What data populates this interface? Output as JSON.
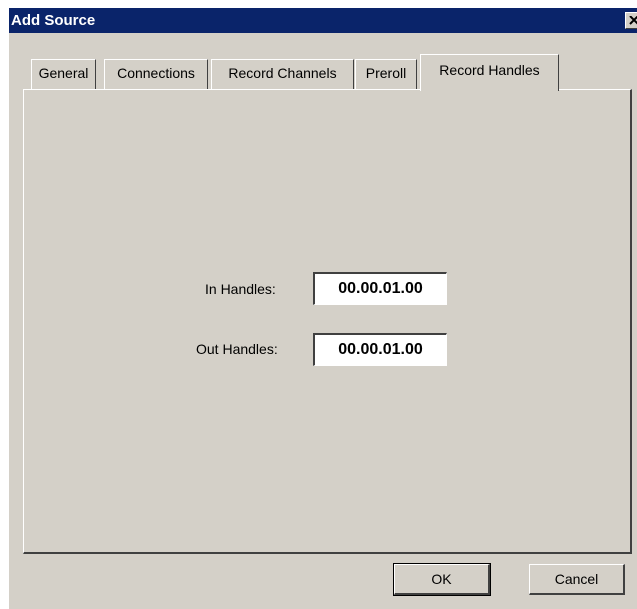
{
  "window": {
    "title": "Add Source"
  },
  "tabs": [
    {
      "label": "General",
      "active": false
    },
    {
      "label": "Connections",
      "active": false
    },
    {
      "label": "Record Channels",
      "active": false
    },
    {
      "label": "Preroll",
      "active": false
    },
    {
      "label": "Record Handles",
      "active": true
    }
  ],
  "record_handles": {
    "in_label": "In Handles:",
    "in_value": "00.00.01.00",
    "out_label": "Out Handles:",
    "out_value": "00.00.01.00"
  },
  "buttons": {
    "ok_label": "OK",
    "cancel_label": "Cancel"
  },
  "icons": {
    "close": "close-icon"
  },
  "colors": {
    "titlebar": "#0a246a",
    "face": "#d4d0c8"
  }
}
